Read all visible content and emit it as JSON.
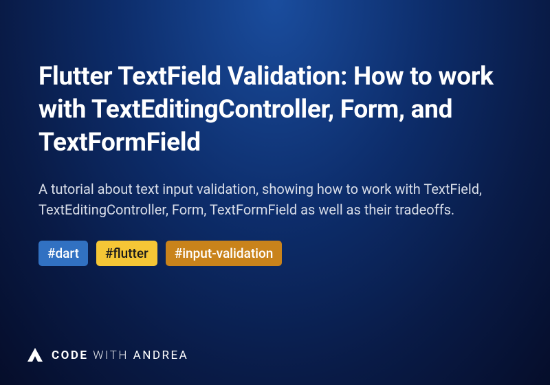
{
  "title": "Flutter TextField Validation: How to work with TextEditingController, Form, and TextFormField",
  "description": "A tutorial about text input validation, showing how to work with TextField, TextEditingController, Form, TextFormField as well as their tradeoffs.",
  "tags": [
    {
      "label": "#dart",
      "key": "dart"
    },
    {
      "label": "#flutter",
      "key": "flutter"
    },
    {
      "label": "#input-validation",
      "key": "input-validation"
    }
  ],
  "brand": {
    "code": "CODE",
    "with": "WITH",
    "andrea": "ANDREA"
  }
}
